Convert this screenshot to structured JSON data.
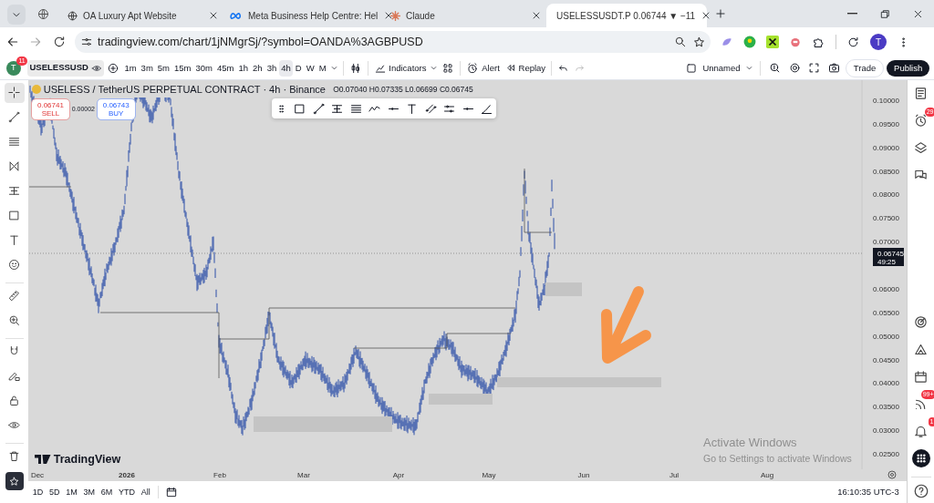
{
  "browser": {
    "tabs": [
      {
        "title": "OA Luxury Apt Website",
        "kind": "globe",
        "selected": false
      },
      {
        "title": "Meta Business Help Centre: Hel",
        "kind": "meta",
        "selected": false
      },
      {
        "title": "Claude",
        "kind": "spark",
        "selected": false
      },
      {
        "title": "USELESSUSDT.P 0.06744 ▼ −11",
        "kind": "chart",
        "selected": true
      }
    ],
    "url": "tradingview.com/chart/1jNMgrSj/?symbol=OANDA%3AGBPUSD",
    "profile": "T"
  },
  "toolbar": {
    "avatar": "T",
    "avatar_badge": "11",
    "symbol": "USELESSUSD",
    "intervals": [
      {
        "label": "1m",
        "selected": false
      },
      {
        "label": "3m",
        "selected": false
      },
      {
        "label": "5m",
        "selected": false
      },
      {
        "label": "15m",
        "selected": false
      },
      {
        "label": "30m",
        "selected": false
      },
      {
        "label": "45m",
        "selected": false
      },
      {
        "label": "1h",
        "selected": false
      },
      {
        "label": "2h",
        "selected": false
      },
      {
        "label": "3h",
        "selected": false
      },
      {
        "label": "4h",
        "selected": true
      },
      {
        "label": "D",
        "selected": false
      },
      {
        "label": "W",
        "selected": false
      },
      {
        "label": "M",
        "selected": false
      }
    ],
    "indicators": "Indicators",
    "alert": "Alert",
    "replay": "Replay",
    "layout": "Unnamed",
    "trade": "Trade",
    "publish": "Publish"
  },
  "left_tools": [
    {
      "kind": "crosshair",
      "selected": true
    },
    {
      "kind": "trend",
      "selected": false
    },
    {
      "kind": "fib",
      "selected": false
    },
    {
      "kind": "pattern",
      "selected": false
    },
    {
      "kind": "projection",
      "selected": false
    },
    {
      "kind": "rectangle",
      "selected": false
    },
    {
      "kind": "text",
      "selected": false
    },
    {
      "kind": "smiley",
      "selected": false
    },
    {
      "kind": "ruler",
      "selected": false
    },
    {
      "kind": "zoom",
      "selected": false
    },
    {
      "kind": "magnet",
      "selected": false
    },
    {
      "kind": "pencil-lock",
      "selected": false
    },
    {
      "kind": "lock",
      "selected": false
    },
    {
      "kind": "eye",
      "selected": false
    },
    {
      "kind": "trash",
      "selected": false
    }
  ],
  "legend": {
    "title": "USELESS / TetherUS PERPETUAL CONTRACT · 4h · Binance",
    "ohlc": "O0.07040 H0.07335 L0.06699 C0.06745"
  },
  "quote": {
    "sell_price": "0.06741",
    "sell": "SELL",
    "spread": "0.00002",
    "buy_price": "0.06743",
    "buy": "BUY"
  },
  "price_axis": {
    "labels": [
      "0.10000",
      "0.09500",
      "0.09000",
      "0.08500",
      "0.08000",
      "0.07500",
      "0.07000",
      "0.06000",
      "0.05500",
      "0.05000",
      "0.04500",
      "0.04000",
      "0.03500",
      "0.03000",
      "0.02500"
    ],
    "current_price": "0.06745",
    "countdown": "49:25"
  },
  "time_axis": {
    "labels": [
      {
        "label": "Dec",
        "bold": false
      },
      {
        "label": "2026",
        "bold": true
      },
      {
        "label": "Feb",
        "bold": false
      },
      {
        "label": "Mar",
        "bold": false
      },
      {
        "label": "Apr",
        "bold": false
      },
      {
        "label": "May",
        "bold": false
      },
      {
        "label": "Jun",
        "bold": false
      },
      {
        "label": "Jul",
        "bold": false
      },
      {
        "label": "Aug",
        "bold": false
      }
    ]
  },
  "logo": "TradingView",
  "right_tools": [
    {
      "kind": "watchlist"
    },
    {
      "kind": "alarm",
      "badge": "29"
    },
    {
      "kind": "layers"
    },
    {
      "kind": "chat"
    },
    {
      "kind": "target"
    },
    {
      "kind": "ideas"
    },
    {
      "kind": "calendar"
    },
    {
      "kind": "feed",
      "badge": "99+"
    },
    {
      "kind": "bell",
      "badge": "1"
    },
    {
      "kind": "apps"
    }
  ],
  "ranges": [
    "1D",
    "5D",
    "1M",
    "3M",
    "6M",
    "YTD",
    "All"
  ],
  "clock": "16:10:35 UTC-3",
  "windows_notice": {
    "title": "Activate Windows",
    "subtitle": "Go to Settings to activate Windows"
  }
}
